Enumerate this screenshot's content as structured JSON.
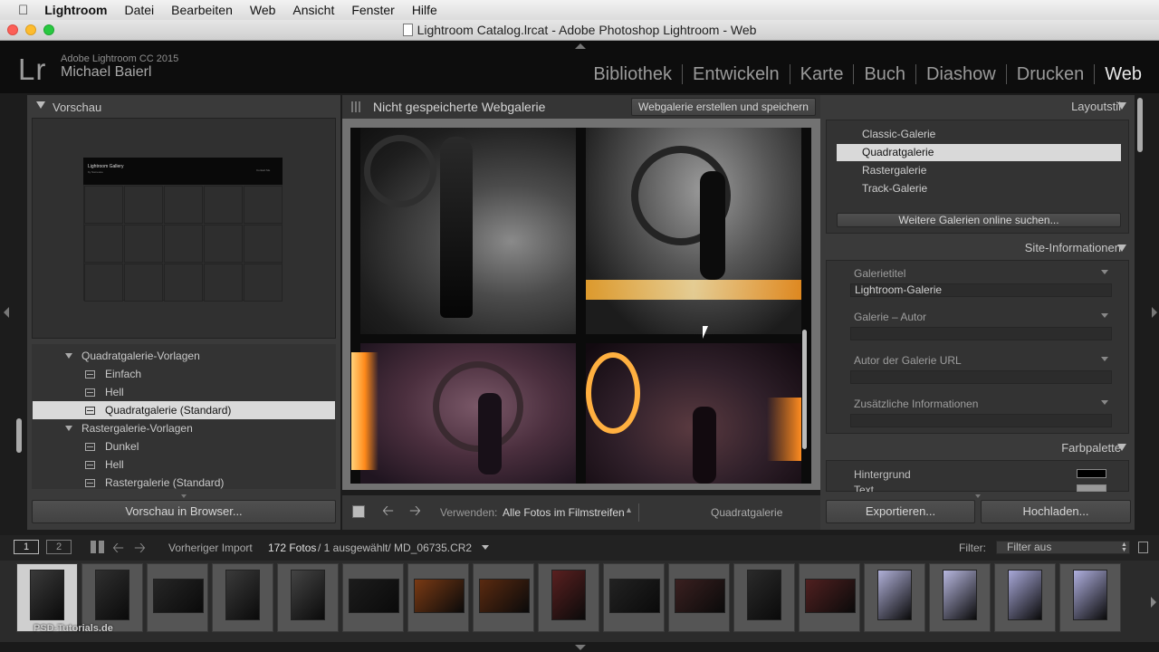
{
  "menubar": {
    "app": "Lightroom",
    "items": [
      "Datei",
      "Bearbeiten",
      "Web",
      "Ansicht",
      "Fenster",
      "Hilfe"
    ]
  },
  "window": {
    "title": "Lightroom Catalog.lrcat - Adobe Photoshop Lightroom - Web"
  },
  "identity": {
    "logo": "Lr",
    "version": "Adobe Lightroom CC 2015",
    "user": "Michael Baierl"
  },
  "modules": [
    "Bibliothek",
    "Entwickeln",
    "Karte",
    "Buch",
    "Diashow",
    "Drucken",
    "Web"
  ],
  "active_module": "Web",
  "left": {
    "preview_title": "Vorschau",
    "thumb_title": "Lightroom Gallery",
    "thumb_sub": "by Someone",
    "thumb_right": "Contact Me",
    "templates": [
      {
        "label": "Quadratgalerie-Vorlagen",
        "type": "folder"
      },
      {
        "label": "Einfach",
        "type": "item"
      },
      {
        "label": "Hell",
        "type": "item"
      },
      {
        "label": "Quadratgalerie (Standard)",
        "type": "item",
        "selected": true
      },
      {
        "label": "Rastergalerie-Vorlagen",
        "type": "folder"
      },
      {
        "label": "Dunkel",
        "type": "item"
      },
      {
        "label": "Hell",
        "type": "item"
      },
      {
        "label": "Rastergalerie (Standard)",
        "type": "item"
      }
    ],
    "preview_button": "Vorschau in Browser..."
  },
  "center": {
    "title": "Nicht gespeicherte Webgalerie",
    "save_button": "Webgalerie erstellen und speichern",
    "use_label": "Verwenden:",
    "use_value": "Alle Fotos im Filmstreifen",
    "layout_name": "Quadratgalerie"
  },
  "right": {
    "layout_title": "Layoutstil",
    "layouts": [
      "Classic-Galerie",
      "Quadratgalerie",
      "Rastergalerie",
      "Track-Galerie"
    ],
    "selected_layout": "Quadratgalerie",
    "more_button": "Weitere Galerien online suchen...",
    "site_title": "Site-Informationen",
    "fields": [
      {
        "label": "Galerietitel",
        "value": "Lightroom-Galerie"
      },
      {
        "label": "Galerie – Autor",
        "value": ""
      },
      {
        "label": "Autor der Galerie URL",
        "value": ""
      },
      {
        "label": "Zusätzliche Informationen",
        "value": ""
      }
    ],
    "palette_title": "Farbpalette",
    "palette": [
      {
        "label": "Hintergrund",
        "color": "#000000"
      },
      {
        "label": "Text",
        "color": "#9a9a9a"
      }
    ],
    "export_button": "Exportieren...",
    "upload_button": "Hochladen..."
  },
  "filmbar": {
    "view1": "1",
    "view2": "2",
    "source": "Vorheriger Import",
    "count": "172 Fotos",
    "selection": "/ 1 ausgewählt/ MD_06735.CR2",
    "filter_label": "Filter:",
    "filter_value": "Filter aus"
  },
  "watermark": "PSD-Tutorials.de",
  "colors": {
    "accent": "#e8e8e8",
    "bg": "#1c1c1c",
    "panel": "#3a3a3a"
  }
}
